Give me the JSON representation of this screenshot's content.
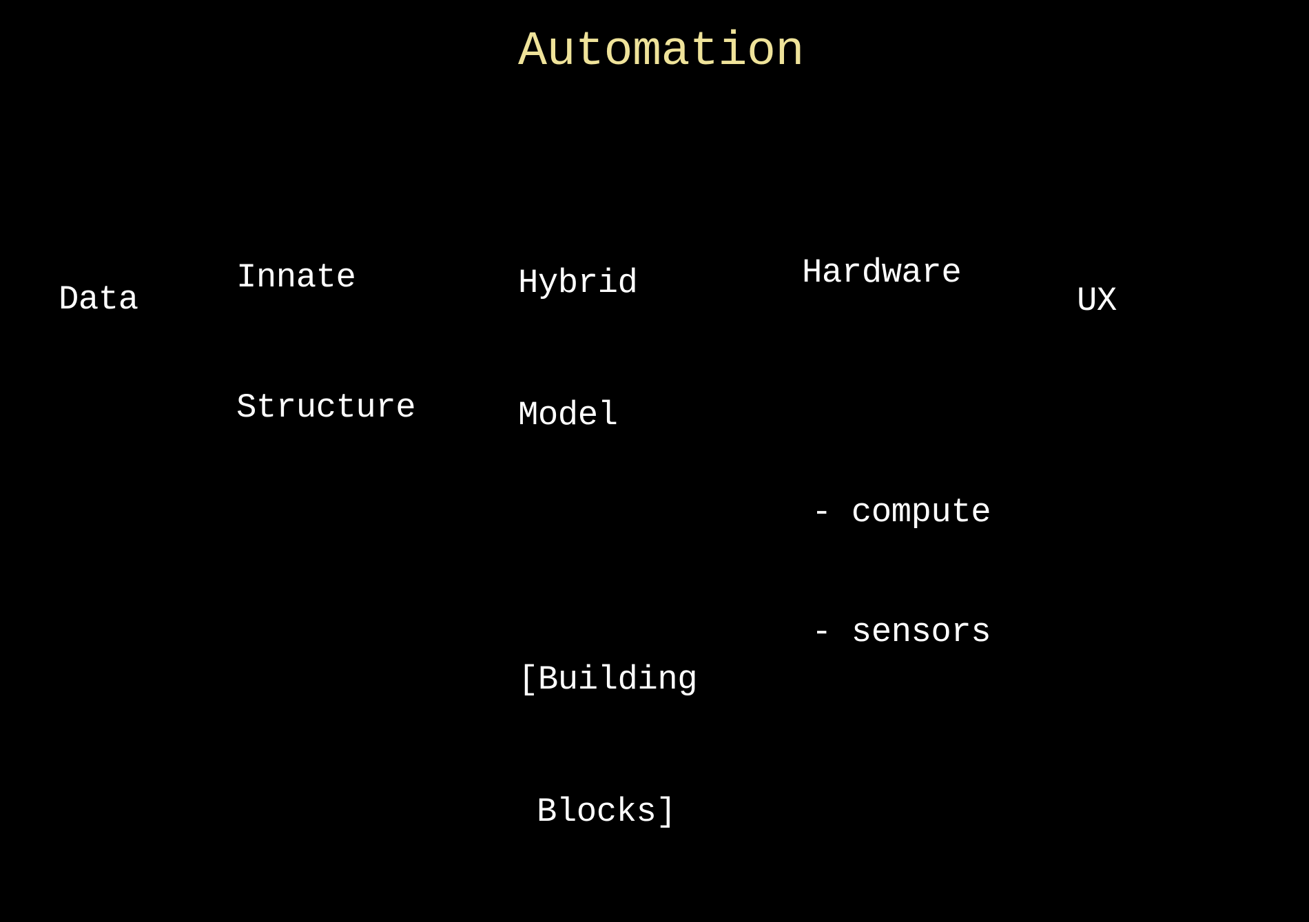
{
  "slide": {
    "title": "Automation",
    "title_color": "#efe39a",
    "text_color": "#ffffff",
    "background_color": "#000000",
    "columns": [
      {
        "id": "data",
        "lines": [
          "Data"
        ]
      },
      {
        "id": "innate-structure",
        "lines": [
          "Innate",
          "Structure"
        ]
      },
      {
        "id": "hybrid-model",
        "lines": [
          "Hybrid",
          "Model"
        ],
        "sub_lines": [
          "[Building",
          "Blocks]"
        ]
      },
      {
        "id": "hardware",
        "lines": [
          "Hardware"
        ],
        "sub_lines": [
          "- compute",
          "- sensors"
        ]
      },
      {
        "id": "ux",
        "lines": [
          "UX"
        ]
      }
    ]
  }
}
